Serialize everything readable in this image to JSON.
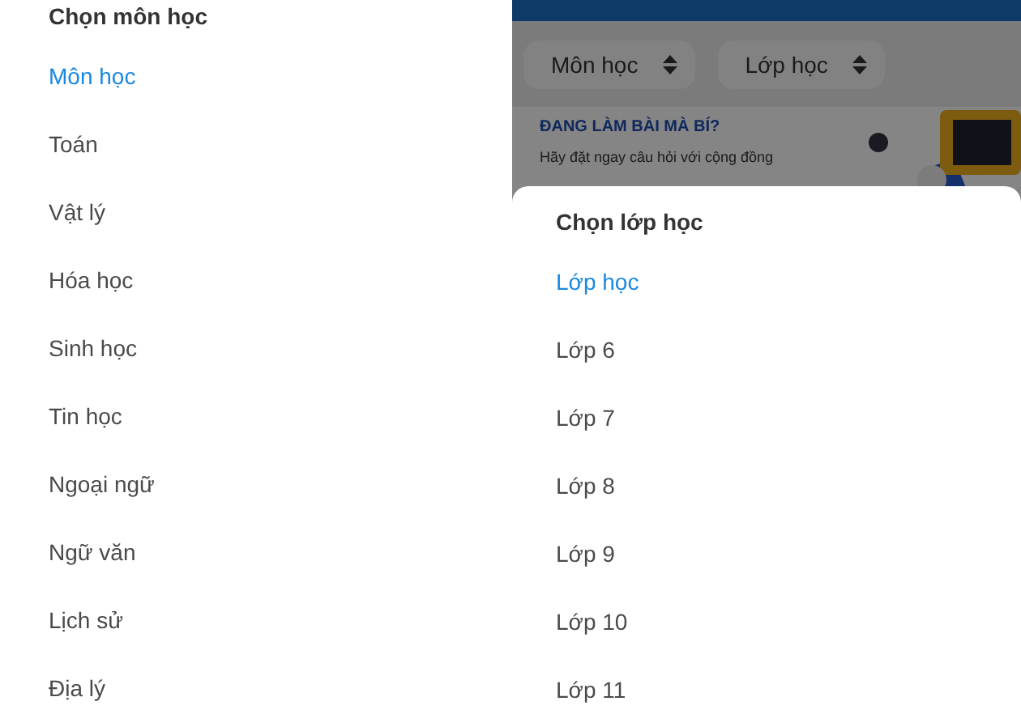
{
  "subject_sheet": {
    "title": "Chọn môn học",
    "items": [
      {
        "label": "Môn học",
        "selected": true
      },
      {
        "label": "Toán",
        "selected": false
      },
      {
        "label": "Vật lý",
        "selected": false
      },
      {
        "label": "Hóa học",
        "selected": false
      },
      {
        "label": "Sinh học",
        "selected": false
      },
      {
        "label": "Tin học",
        "selected": false
      },
      {
        "label": "Ngoại ngữ",
        "selected": false
      },
      {
        "label": "Ngữ văn",
        "selected": false
      },
      {
        "label": "Lịch sử",
        "selected": false
      },
      {
        "label": "Địa lý",
        "selected": false
      }
    ]
  },
  "background": {
    "filters": [
      {
        "label": "Môn học"
      },
      {
        "label": "Lớp học"
      }
    ],
    "banner": {
      "title": "ĐANG LÀM BÀI MÀ BÍ?",
      "subtitle": "Hãy đặt ngay câu hỏi với cộng đồng"
    }
  },
  "grade_sheet": {
    "title": "Chọn lớp học",
    "items": [
      {
        "label": "Lớp học",
        "selected": true
      },
      {
        "label": "Lớp 6",
        "selected": false
      },
      {
        "label": "Lớp 7",
        "selected": false
      },
      {
        "label": "Lớp 8",
        "selected": false
      },
      {
        "label": "Lớp 9",
        "selected": false
      },
      {
        "label": "Lớp 10",
        "selected": false
      },
      {
        "label": "Lớp 11",
        "selected": false
      }
    ]
  }
}
